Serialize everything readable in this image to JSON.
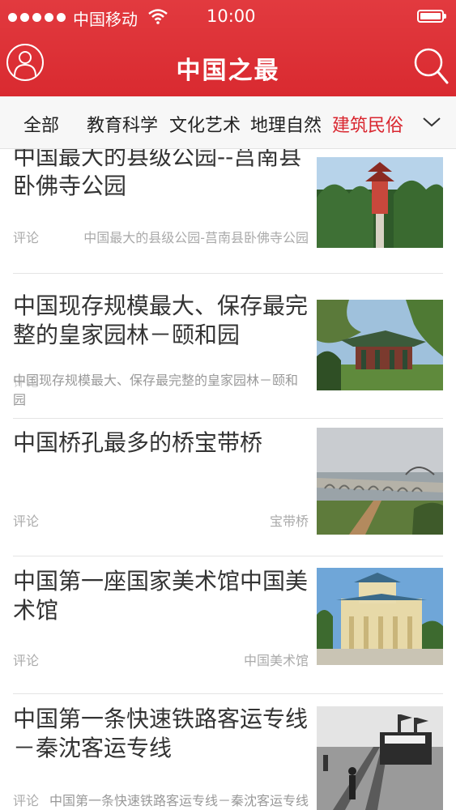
{
  "status_bar": {
    "carrier": "中国移动",
    "time": "10:00"
  },
  "header": {
    "title": "中国之最"
  },
  "tabs": [
    {
      "label": "全部",
      "active": false
    },
    {
      "label": "教育科学",
      "active": false
    },
    {
      "label": "文化艺术",
      "active": false
    },
    {
      "label": "地理自然",
      "active": false
    },
    {
      "label": "建筑民俗",
      "active": true
    }
  ],
  "articles": [
    {
      "title": "中国最大的县级公园--莒南县卧佛寺公园",
      "comment_label": "评论",
      "tag": "中国最大的县级公园-莒南县卧佛寺公园",
      "thumbnail": "pagoda-park-photo"
    },
    {
      "title": "中国现存规模最大、保存最完整的皇家园林－颐和园",
      "comment_label": "评论",
      "tag": "中国现存规模最大、保存最完整的皇家园林－颐和园",
      "thumbnail": "summer-palace-photo"
    },
    {
      "title": "中国桥孔最多的桥宝带桥",
      "comment_label": "评论",
      "tag": "宝带桥",
      "thumbnail": "baodai-bridge-photo"
    },
    {
      "title": "中国第一座国家美术馆中国美术馆",
      "comment_label": "评论",
      "tag": "中国美术馆",
      "thumbnail": "art-museum-photo"
    },
    {
      "title": "中国第一条快速铁路客运专线－秦沈客运专线",
      "comment_label": "评论",
      "tag": "中国第一条快速铁路客运专线－秦沈客运专线",
      "thumbnail": "railway-photo"
    }
  ],
  "colors": {
    "brand_red": "#d9262f",
    "text": "#333333",
    "muted": "#aaaaaa"
  }
}
